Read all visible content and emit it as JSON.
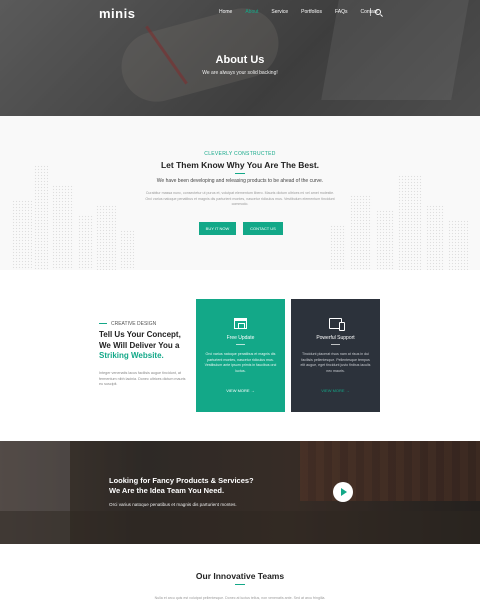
{
  "nav": {
    "logo": "minis",
    "items": [
      "Home",
      "About",
      "Service",
      "Portfolios",
      "FAQs",
      "Contact"
    ],
    "active": "About"
  },
  "hero": {
    "title": "About Us",
    "subtitle": "We are always your solid backing!"
  },
  "about": {
    "eyebrow": "CLEVERLY CONSTRUCTED",
    "title": "Let Them Know Why You Are The Best.",
    "lead": "We have been developing and releasing products to be ahead of the curve.",
    "body": "Curabitur massa nunc, consectetur ut purus et, volutpat elementum libero. Mauris dictum ultrices mi vel amet molestie. Orci varius natoque penatibus et magnis dis parturient montes, nascetur ridiculus mus. Vestibulum elementum tincidunt commodo.",
    "buy_label": "BUY IT NOW",
    "contact_label": "CONTACT US"
  },
  "services": {
    "eyebrow": "CREATIVE DESIGN",
    "heading_line1": "Tell Us Your Concept,",
    "heading_line2": "We Will Deliver You a",
    "heading_accent": "Striking Website.",
    "body": "Integer venenatis lacus facilisis augue tincidunt, at fermentum nibh lacinia. Donec ultrices dictum mauris eu suscipit.",
    "cards": [
      {
        "icon": "shop-icon",
        "title": "Free Update",
        "text": "Orci varius natoque penatibus et magnis dis parturient montes, nascetur ridiculus mus. Vestibulum ante ipsum primis in faucibus orci luctus.",
        "more": "VIEW MORE"
      },
      {
        "icon": "devices-icon",
        "title": "Powerful Support",
        "text": "Tincidunt placerat risus nam at risus in dui facilisis pellentesque. Pellentesque tempus elit augue, eget tincidunt justo finibus iaculis nec mauris.",
        "more": "VIEW MORE"
      }
    ],
    "arrow": "→"
  },
  "banner": {
    "title_line1": "Looking for Fancy Products & Services?",
    "title_line2": "We Are the Idea Team You Need.",
    "subtitle": "Orci varius natoque penatibus et magnis dis parturient montes."
  },
  "teams": {
    "title": "Our Innovative Teams",
    "body": "Nulla et arcu quis est volutpat pellentesque. Donec at luctus tellus, non venenatis ante. Sed at arcu fringilla."
  },
  "colors": {
    "accent": "#13a888",
    "dark_card": "#2c323b"
  }
}
